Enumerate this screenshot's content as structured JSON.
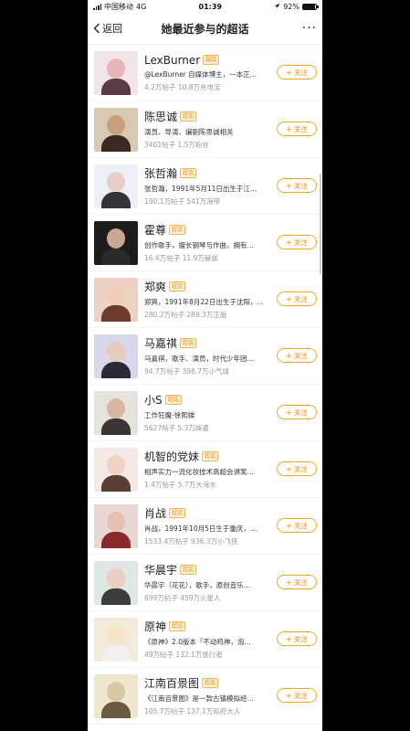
{
  "status_bar": {
    "carrier": "中国移动",
    "network": "4G",
    "time": "01:39",
    "battery": "92%",
    "battery_level": 0.92
  },
  "nav": {
    "back_label": "返回",
    "title": "她最近参与的超话",
    "more": "···"
  },
  "tag_label": "超话",
  "follow_label": "+ 关注",
  "items": [
    {
      "name": "LexBurner",
      "desc": "@LexBurner  自媒体博主，一本正…",
      "stats": "4.2万帖子  10.8万充电宝",
      "colors": [
        "#f1e4ea",
        "#e7b5b9",
        "#5b3c44"
      ]
    },
    {
      "name": "陈思诚",
      "desc": "演员、导演、编剧陈思诚相关",
      "stats": "3401帖子  1.5万粉丝",
      "colors": [
        "#d8c9b5",
        "#c9a07f",
        "#3a2a24"
      ]
    },
    {
      "name": "张哲瀚",
      "desc": "张哲瀚，1991年5月11日出生于江…",
      "stats": "190.1万帖子  541万海带",
      "colors": [
        "#eef0f7",
        "#e7cfc8",
        "#35333a"
      ]
    },
    {
      "name": "霍尊",
      "desc": "创作歌手，擅长钢琴与作曲，拥有…",
      "stats": "16.4万帖子  11.9万赫兹",
      "colors": [
        "#1d1d1d",
        "#c9a792",
        "#2a2a2a"
      ]
    },
    {
      "name": "郑爽",
      "desc": "郑爽，1991年8月22日出生于沈阳，…",
      "stats": "280.2万帖子  289.3万正版",
      "colors": [
        "#ecd2c4",
        "#f0cdb8",
        "#6b3b2c"
      ]
    },
    {
      "name": "马嘉祺",
      "desc": "马嘉祺，歌手、演员，时代少年团…",
      "stats": "94.7万帖子  398.7万小气球",
      "colors": [
        "#d9d7ea",
        "#e8cabd",
        "#2c2a38"
      ]
    },
    {
      "name": "小S",
      "desc": "工作狂魔-徐熙娣",
      "stats": "5627帖子  5.3万妹婆",
      "colors": [
        "#e6e2de",
        "#d7b7a2",
        "#3b3633"
      ]
    },
    {
      "name": "机智的党妹",
      "desc": "相声实力一流化妆技术高超会讲笑…",
      "stats": "1.4万帖子  5.7万大海水",
      "colors": [
        "#f3e9e6",
        "#f1d2c6",
        "#5a3d35"
      ]
    },
    {
      "name": "肖战",
      "desc": "肖战，1991年10月5日生于重庆，…",
      "stats": "1533.4万帖子  936.3万小飞侠",
      "colors": [
        "#e8d8d4",
        "#e3c2b0",
        "#8a2a2e"
      ]
    },
    {
      "name": "华晨宇",
      "desc": "华晨宇（花花），歌手，原创音乐…",
      "stats": "699万帖子  459万火星人",
      "colors": [
        "#dfe6e3",
        "#e9cfc1",
        "#3d3d3d"
      ]
    },
    {
      "name": "原神",
      "desc": "《原神》2.0版本「不动鸣神，泡…",
      "stats": "49万帖子  132.1万旅行者",
      "colors": [
        "#f4ead9",
        "#f6e3c8",
        "#f2f0f3"
      ]
    },
    {
      "name": "江南百景图",
      "desc": "《江南百景图》是一款古镇模拟经…",
      "stats": "105.7万帖子  137.1万知府大人",
      "colors": [
        "#efe6d0",
        "#d8c7a6",
        "#6a5c42"
      ]
    }
  ]
}
